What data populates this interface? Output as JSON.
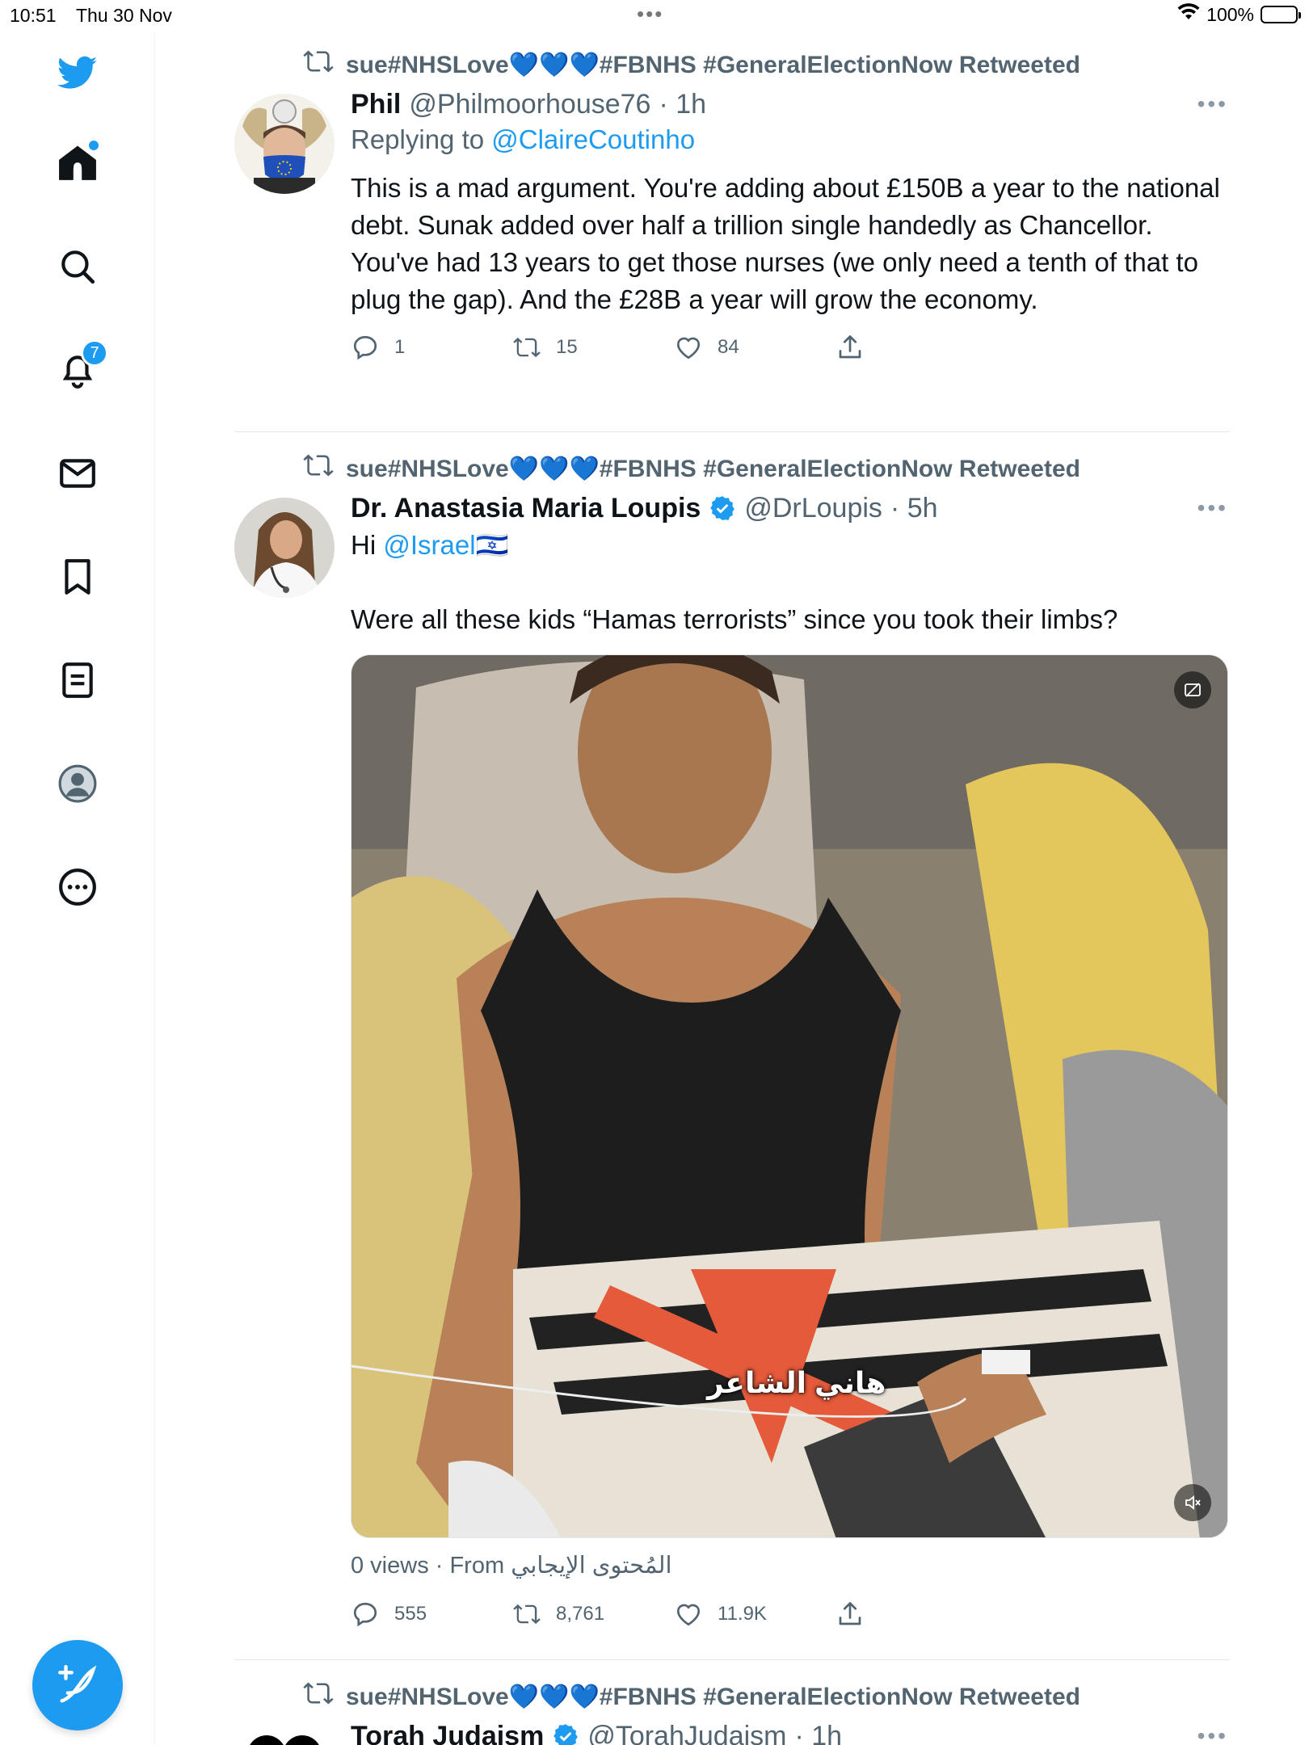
{
  "status_bar": {
    "time": "10:51",
    "date": "Thu 30 Nov",
    "battery": "100%"
  },
  "sidebar": {
    "items": [
      {
        "name": "twitter-logo-icon"
      },
      {
        "name": "home-icon"
      },
      {
        "name": "search-icon"
      },
      {
        "name": "notifications-icon",
        "badge": "7"
      },
      {
        "name": "messages-icon"
      },
      {
        "name": "bookmarks-icon"
      },
      {
        "name": "lists-icon"
      },
      {
        "name": "profile-icon"
      },
      {
        "name": "more-icon"
      }
    ],
    "compose_icon": "compose-tweet-icon"
  },
  "tweets": [
    {
      "retweeted_by": "sue#NHSLove💙💙💙#FBNHS #GeneralElectionNow Retweeted",
      "display_name": "Phil",
      "handle": "@Philmoorhouse76",
      "time": "· 1h",
      "replying_prefix": "Replying to ",
      "replying_to": "@ClaireCoutinho",
      "text": "This is a mad argument. You're adding about £150B a year to the national debt. Sunak added over half a trillion single handedly as Chancellor. You've had 13 years to get those nurses (we only need a tenth of that to plug the gap). And the £28B a year will grow the economy.",
      "replies": "1",
      "retweets": "15",
      "likes": "84"
    },
    {
      "retweeted_by": "sue#NHSLove💙💙💙#FBNHS #GeneralElectionNow Retweeted",
      "display_name": "Dr. Anastasia Maria Loupis",
      "handle": "@DrLoupis",
      "time": "· 5h",
      "text_prefix": "Hi ",
      "mention": "@Israel",
      "flag": "🇮🇱",
      "text_body": "Were all these kids “Hamas terrorists” since you took their limbs?",
      "media_caption": "هاني الشاعر",
      "views": "0 views · From المُحتوى الإيجابي",
      "replies": "555",
      "retweets": "8,761",
      "likes": "11.9K"
    },
    {
      "retweeted_by": "sue#NHSLove💙💙💙#FBNHS #GeneralElectionNow Retweeted",
      "display_name": "Torah Judaism",
      "handle": "@TorahJudaism",
      "time": "· 1h"
    }
  ],
  "colors": {
    "accent": "#1d9bf0",
    "secondary_text": "#536471",
    "primary_text": "#0f1419"
  }
}
